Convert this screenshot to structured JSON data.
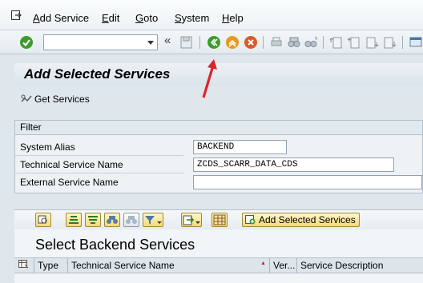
{
  "menubar": {
    "items": [
      {
        "label": "Add Service",
        "acc": "A",
        "rest": "dd Service"
      },
      {
        "label": "Edit",
        "acc": "E",
        "rest": "dit"
      },
      {
        "label": "Goto",
        "acc": "G",
        "rest": "oto"
      },
      {
        "label": "System",
        "acc": "S",
        "rest": "ystem"
      },
      {
        "label": "Help",
        "acc": "H",
        "rest": "elp"
      }
    ]
  },
  "toolbar": {
    "command_field_value": "",
    "chevron": "«"
  },
  "page": {
    "title": "Add Selected Services",
    "get_services_label": "Get Services"
  },
  "filter": {
    "heading": "Filter",
    "fields": [
      {
        "label": "System Alias",
        "value": "BACKEND"
      },
      {
        "label": "Technical Service Name",
        "value": "ZCDS_SCARR_DATA_CDS"
      },
      {
        "label": "External Service Name",
        "value": ""
      }
    ]
  },
  "alv": {
    "add_selected_label": "Add Selected Services",
    "title": "Select Backend Services",
    "columns": [
      "Type",
      "Technical Service Name",
      "Ver...",
      "Service Description"
    ]
  },
  "colors": {
    "accent_green": "#3f9a2f",
    "accent_orange": "#e79a1f",
    "annotation_red": "#d8262c"
  }
}
